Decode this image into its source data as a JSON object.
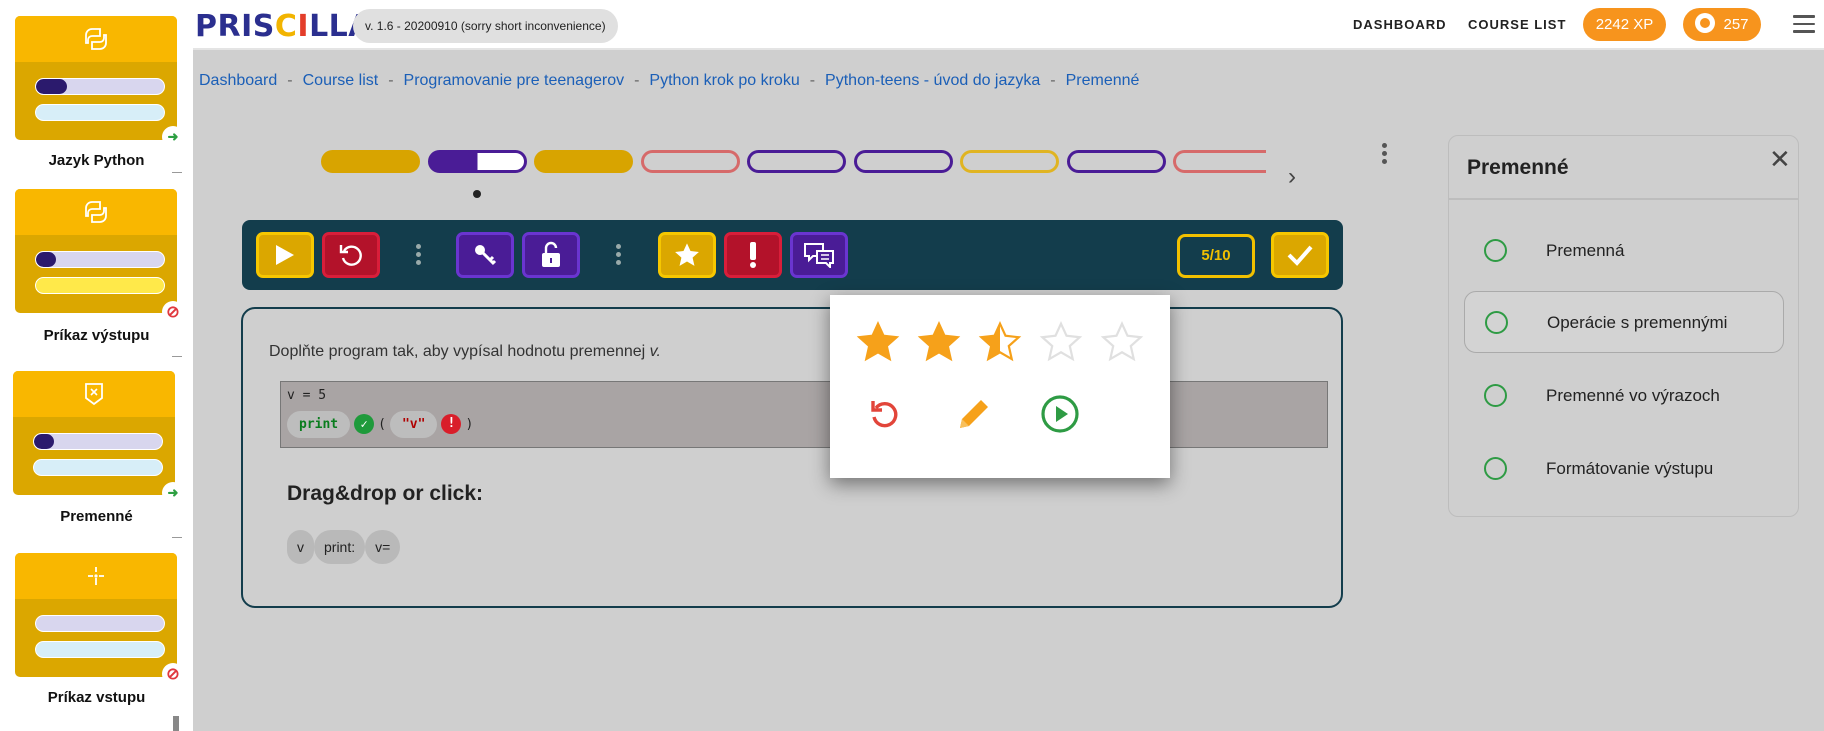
{
  "sidebar": {
    "lessons": [
      {
        "title": "Jazyk Python",
        "icon": "python-icon",
        "status": "go-icon"
      },
      {
        "title": "Príkaz výstupu",
        "icon": "python-icon",
        "status": "blocked-icon"
      },
      {
        "title": "Premenné",
        "icon": "variable-box-icon",
        "status": "go-icon"
      },
      {
        "title": "Príkaz vstupu",
        "icon": "input-sparkle-icon",
        "status": "blocked-icon"
      }
    ]
  },
  "header": {
    "logo": {
      "p1": "PRIS",
      "c1": "C",
      "i": "I",
      "rest": "LLA"
    },
    "version": "v. 1.6 - 20200910 (sorry short inconvenience)",
    "nav": {
      "dashboard": "DASHBOARD",
      "course_list": "COURSE LIST"
    },
    "xp": "2242 XP",
    "coins": "257"
  },
  "breadcrumb": {
    "items": [
      "Dashboard",
      "Course list",
      "Programovanie pre teenagerov",
      "Python krok po kroku",
      "Python-teens - úvod do jazyka",
      "Premenné"
    ],
    "separator": "-"
  },
  "tasks": {
    "pills": [
      {
        "state": "done",
        "color": "#d8a400"
      },
      {
        "state": "current",
        "color": "#4a1c96",
        "progress": 0.5
      },
      {
        "state": "done",
        "color": "#d8a400"
      },
      {
        "state": "outline",
        "color": "#d66a6a"
      },
      {
        "state": "outline",
        "color": "#4a1c96"
      },
      {
        "state": "outline",
        "color": "#4a1c96"
      },
      {
        "state": "outline",
        "color": "#e0b422"
      },
      {
        "state": "outline",
        "color": "#4a1c96"
      },
      {
        "state": "outline",
        "color": "#d66a6a"
      }
    ]
  },
  "toolbar": {
    "score": "5/10"
  },
  "task": {
    "instruction": "Doplňte program tak, aby vypísal hodnotu premennej",
    "instruction_var": "v.",
    "code_line1": "v = 5",
    "code_print": "print",
    "code_open": "(",
    "code_string": "\"v\"",
    "code_close": ")",
    "ok_mark": "✓",
    "err_mark": "!",
    "drag_title": "Drag&drop or click:",
    "chips": [
      "v",
      "print:",
      "v="
    ]
  },
  "rating": {
    "stars": 2.5,
    "max": 5
  },
  "right_panel": {
    "title": "Premenné",
    "close": "✕",
    "items": [
      "Premenná",
      "Operácie s premennými",
      "Premenné vo výrazoch",
      "Formátovanie výstupu"
    ],
    "active_index": 1
  }
}
